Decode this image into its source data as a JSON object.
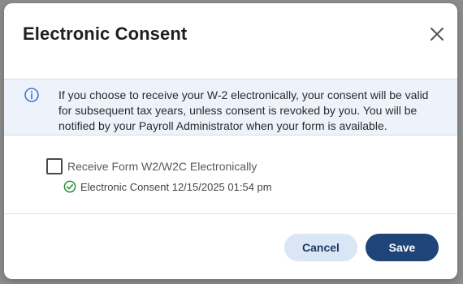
{
  "dialog": {
    "title": "Electronic Consent",
    "close_icon": "close-icon"
  },
  "info_banner": {
    "icon": "info-icon",
    "text": "If you choose to receive your W-2 electronically, your consent will be valid for subsequent tax years, unless consent is revoked by you. You will be notified by your Payroll Administrator when your form is available."
  },
  "consent": {
    "checkbox_label": "Receive Form W2/W2C Electronically",
    "checked": false,
    "status_icon": "check-circle-icon",
    "status_text": "Electronic Consent 12/15/2025 01:54 pm"
  },
  "footer": {
    "cancel_label": "Cancel",
    "save_label": "Save"
  },
  "colors": {
    "primary": "#1e4478",
    "secondary": "#dae5f5",
    "info_background": "#eef3fb",
    "info_icon": "#4a6fd8",
    "success": "#2e8b3d",
    "backdrop": "#8c8c8c"
  }
}
